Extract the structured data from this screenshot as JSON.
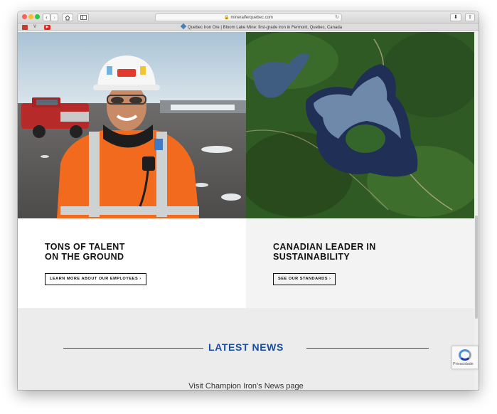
{
  "browser": {
    "url": "mineraiferquebec.com",
    "tab_title": "Quebec Iron Ore | Bloom Lake Mine: first-grade iron in Fermont, Quebec, Canada"
  },
  "cards": [
    {
      "title_line1": "TONS OF TALENT",
      "title_line2": "ON THE GROUND",
      "button": "LEARN MORE ABOUT OUR EMPLOYEES ›"
    },
    {
      "title_line1": "CANADIAN LEADER IN",
      "title_line2": "SUSTAINABILITY",
      "button": "SEE OUR STANDARDS ›"
    }
  ],
  "news": {
    "title": "LATEST NEWS",
    "link": "Visit Champion Iron's News page"
  },
  "recaptcha": {
    "label": "Privacidade"
  },
  "colors": {
    "accent": "#1a4e9c",
    "safety_orange": "#f26a1e"
  }
}
